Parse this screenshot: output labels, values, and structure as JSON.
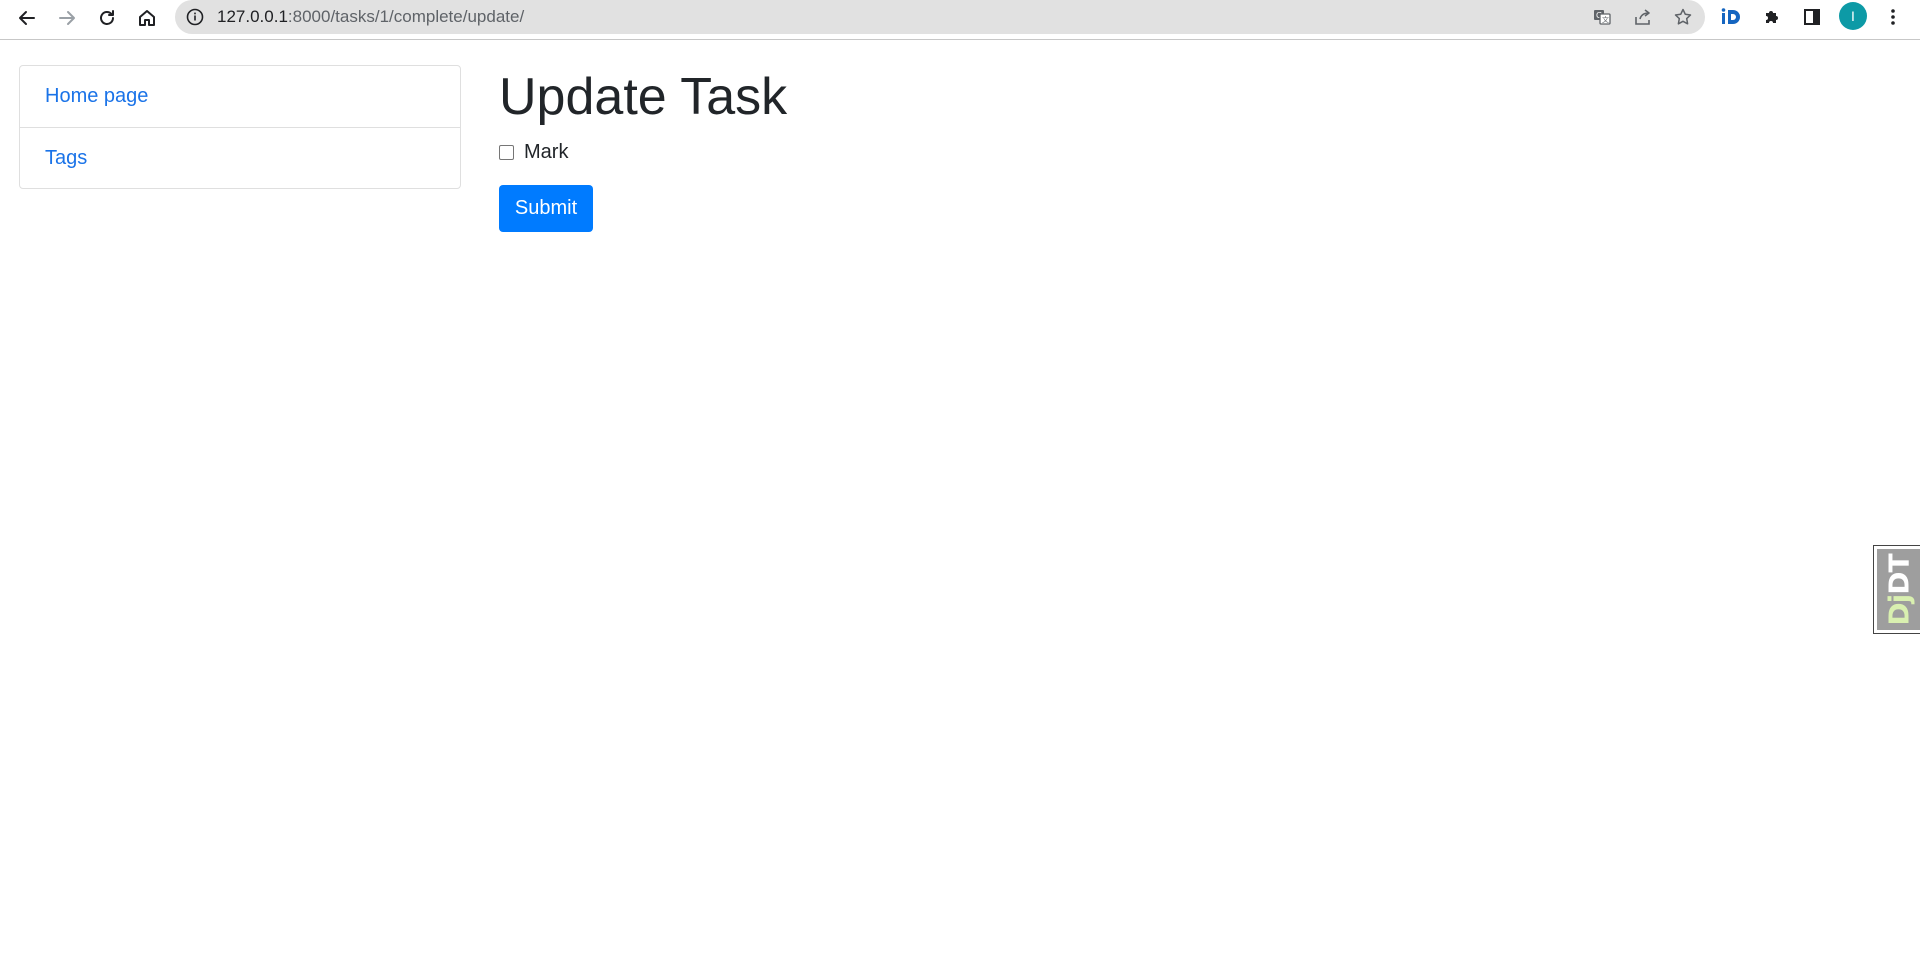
{
  "browser": {
    "url_host": "127.0.0.1",
    "url_rest": ":8000/tasks/1/complete/update/",
    "avatar_letter": "I",
    "icons": [
      "back-arrow-icon",
      "forward-arrow-icon",
      "reload-icon",
      "home-icon",
      "site-info-icon",
      "translate-icon",
      "share-icon",
      "bookmark-star-icon",
      "extension-id-icon",
      "puzzle-extensions-icon",
      "side-panel-icon",
      "kebab-menu-icon"
    ]
  },
  "sidebar": {
    "items": [
      {
        "label": "Home page"
      },
      {
        "label": "Tags"
      }
    ]
  },
  "main": {
    "title": "Update Task",
    "checkbox_label": "Mark",
    "checkbox_checked": false,
    "submit_label": "Submit"
  },
  "debug_toolbar": {
    "prefix": "Dj",
    "suffix": "DT"
  },
  "colors": {
    "link": "#1a73e8",
    "primary_button": "#007bff",
    "avatar": "#0d9aa6",
    "toolbar_handle": "#9e9e9e"
  }
}
